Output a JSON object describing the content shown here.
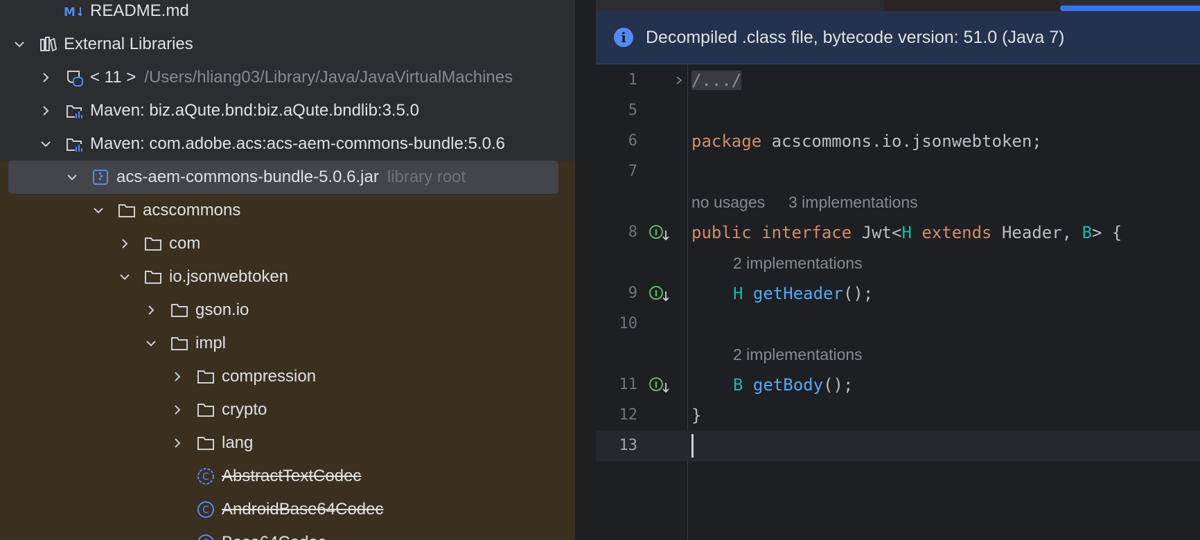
{
  "project_tree": {
    "rows": [
      {
        "label": "README.md",
        "icon": "markdown-file-icon",
        "indent": 0
      },
      {
        "label": "External Libraries",
        "icon": "library-icon",
        "expanded": true
      },
      {
        "label": "< 11 >",
        "path": "/Users/hliang03/Library/Java/JavaVirtualMachines",
        "icon": "jdk-icon",
        "expanded": false
      },
      {
        "label": "Maven: biz.aQute.bnd:biz.aQute.bndlib:3.5.0",
        "icon": "maven-library-icon",
        "expanded": false
      },
      {
        "label": "Maven: com.adobe.acs:acs-aem-commons-bundle:5.0.6",
        "icon": "maven-library-icon",
        "expanded": true
      },
      {
        "label": "acs-aem-commons-bundle-5.0.6.jar",
        "hint": "library root",
        "icon": "jar-icon",
        "expanded": true,
        "selected": true
      },
      {
        "label": "acscommons",
        "icon": "folder-icon",
        "expanded": true
      },
      {
        "label": "com",
        "icon": "folder-icon",
        "expanded": false
      },
      {
        "label": "io.jsonwebtoken",
        "icon": "folder-icon",
        "expanded": true
      },
      {
        "label": "gson.io",
        "icon": "folder-icon",
        "expanded": false
      },
      {
        "label": "impl",
        "icon": "folder-icon",
        "expanded": true
      },
      {
        "label": "compression",
        "icon": "folder-icon",
        "expanded": false
      },
      {
        "label": "crypto",
        "icon": "folder-icon",
        "expanded": false
      },
      {
        "label": "lang",
        "icon": "folder-icon",
        "expanded": false
      },
      {
        "label": "AbstractTextCodec",
        "icon": "class-icon",
        "deprecated": true
      },
      {
        "label": "AndroidBase64Codec",
        "icon": "class-icon",
        "deprecated": true
      },
      {
        "label": "Base64Codec",
        "icon": "class-icon",
        "deprecated": true
      }
    ]
  },
  "editor": {
    "banner": {
      "icon": "info-icon",
      "text": "Decompiled .class file, bytecode version: 51.0 (Java 7)"
    },
    "lines": {
      "n1": "1",
      "n5": "5",
      "n6": "6",
      "n7": "7",
      "n8": "8",
      "n9": "9",
      "n10": "10",
      "n11": "11",
      "n12": "12",
      "n13": "13"
    },
    "code": {
      "fold": "/.../",
      "package_kw": "package",
      "package_name": " acscommons.io.jsonwebtoken;",
      "public_kw": "public",
      "interface_kw": "interface",
      "jwt": " Jwt<",
      "h": "H",
      "extends_kw": "extends",
      "header": " Header, ",
      "b": "B",
      "close_generic": "> {",
      "get_header_type": "H",
      "get_header": "getHeader",
      "parens1": "();",
      "get_body_type": "B",
      "get_body": "getBody",
      "parens2": "();",
      "close_brace": "}"
    },
    "inlays": {
      "no_usages": "no usages",
      "impl3": "3 implementations",
      "impl2a": "2 implementations",
      "impl2b": "2 implementations"
    }
  },
  "colors": {
    "keyword": "#cf8e6d",
    "type_param": "#16baac",
    "method": "#56a8f5",
    "accent": "#3574f0"
  }
}
